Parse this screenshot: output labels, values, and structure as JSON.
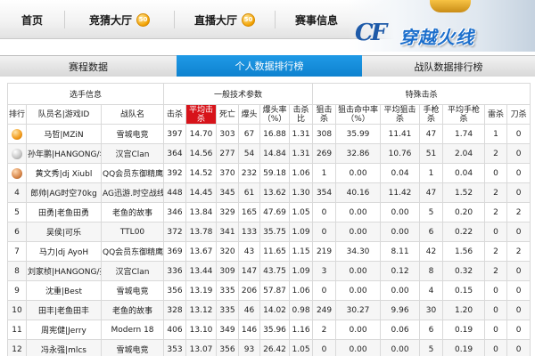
{
  "nav": {
    "items": [
      {
        "label": "首页",
        "badge": ""
      },
      {
        "label": "竞猜大厅",
        "badge": "50"
      },
      {
        "label": "直播大厅",
        "badge": "50"
      },
      {
        "label": "赛事信息",
        "badge": ""
      }
    ],
    "logo_text": "穿越火线",
    "logo_letters": "CF"
  },
  "tabs": [
    {
      "label": "赛程数据",
      "active": false
    },
    {
      "label": "个人数据排行榜",
      "active": true
    },
    {
      "label": "战队数据排行榜",
      "active": false
    }
  ],
  "table": {
    "groups": [
      "选手信息",
      "一般技术参数",
      "特殊击杀"
    ],
    "columns": [
      "排行",
      "队员名|游戏ID",
      "战队名",
      "击杀",
      "平均击杀",
      "死亡",
      "爆头",
      "爆头率（%）",
      "击杀比",
      "狙击杀",
      "狙击命中率（%）",
      "平均狙击杀",
      "手枪杀",
      "平均手枪杀",
      "雷杀",
      "刀杀"
    ],
    "highlight_column": 4,
    "rows": [
      {
        "rank": "",
        "medal": "gold",
        "name": "马哲|MZiN",
        "team": "雪城电竞",
        "kills": "397",
        "avg": "14.70",
        "deaths": "303",
        "hs": "67",
        "hsr": "16.88",
        "kd": "1.31",
        "snipe": "308",
        "snipe_rate": "35.99",
        "avg_snipe": "11.41",
        "pistol": "47",
        "avg_pistol": "1.74",
        "nade": "1",
        "knife": "0"
      },
      {
        "rank": "",
        "medal": "silver",
        "name": "孙年鹏|HANGONG/年鹏",
        "team": "汉宫Clan",
        "kills": "364",
        "avg": "14.56",
        "deaths": "277",
        "hs": "54",
        "hsr": "14.84",
        "kd": "1.31",
        "snipe": "269",
        "snipe_rate": "32.86",
        "avg_snipe": "10.76",
        "pistol": "51",
        "avg_pistol": "2.04",
        "nade": "2",
        "knife": "0"
      },
      {
        "rank": "",
        "medal": "bronze",
        "name": "黄文秀|dj Xiubl",
        "team": "QQ会员东御精鹰",
        "kills": "392",
        "avg": "14.52",
        "deaths": "370",
        "hs": "232",
        "hsr": "59.18",
        "kd": "1.06",
        "snipe": "1",
        "snipe_rate": "0.00",
        "avg_snipe": "0.04",
        "pistol": "1",
        "avg_pistol": "0.04",
        "nade": "0",
        "knife": "0"
      },
      {
        "rank": "4",
        "medal": "",
        "name": "郎帅|AG时空70kg",
        "team": "AG迅游.时空战线",
        "kills": "448",
        "avg": "14.45",
        "deaths": "345",
        "hs": "61",
        "hsr": "13.62",
        "kd": "1.30",
        "snipe": "354",
        "snipe_rate": "40.16",
        "avg_snipe": "11.42",
        "pistol": "47",
        "avg_pistol": "1.52",
        "nade": "2",
        "knife": "0"
      },
      {
        "rank": "5",
        "medal": "",
        "name": "田勇|老鱼田勇",
        "team": "老鱼的故事",
        "kills": "346",
        "avg": "13.84",
        "deaths": "329",
        "hs": "165",
        "hsr": "47.69",
        "kd": "1.05",
        "snipe": "0",
        "snipe_rate": "0.00",
        "avg_snipe": "0.00",
        "pistol": "5",
        "avg_pistol": "0.20",
        "nade": "2",
        "knife": "2"
      },
      {
        "rank": "6",
        "medal": "",
        "name": "吴侯|可乐",
        "team": "TTL00",
        "kills": "372",
        "avg": "13.78",
        "deaths": "341",
        "hs": "133",
        "hsr": "35.75",
        "kd": "1.09",
        "snipe": "0",
        "snipe_rate": "0.00",
        "avg_snipe": "0.00",
        "pistol": "6",
        "avg_pistol": "0.22",
        "nade": "0",
        "knife": "0"
      },
      {
        "rank": "7",
        "medal": "",
        "name": "马力|dj AyoH",
        "team": "QQ会员东御精鹰",
        "kills": "369",
        "avg": "13.67",
        "deaths": "320",
        "hs": "43",
        "hsr": "11.65",
        "kd": "1.15",
        "snipe": "219",
        "snipe_rate": "34.30",
        "avg_snipe": "8.11",
        "pistol": "42",
        "avg_pistol": "1.56",
        "nade": "2",
        "knife": "2"
      },
      {
        "rank": "8",
        "medal": "",
        "name": "刘家桢|HANGONG/亮亮",
        "team": "汉宫Clan",
        "kills": "336",
        "avg": "13.44",
        "deaths": "309",
        "hs": "147",
        "hsr": "43.75",
        "kd": "1.09",
        "snipe": "3",
        "snipe_rate": "0.00",
        "avg_snipe": "0.12",
        "pistol": "8",
        "avg_pistol": "0.32",
        "nade": "2",
        "knife": "0"
      },
      {
        "rank": "9",
        "medal": "",
        "name": "沈重|Best",
        "team": "雪城电竞",
        "kills": "356",
        "avg": "13.19",
        "deaths": "335",
        "hs": "206",
        "hsr": "57.87",
        "kd": "1.06",
        "snipe": "0",
        "snipe_rate": "0.00",
        "avg_snipe": "0.00",
        "pistol": "4",
        "avg_pistol": "0.15",
        "nade": "0",
        "knife": "0"
      },
      {
        "rank": "10",
        "medal": "",
        "name": "田丰|老鱼田丰",
        "team": "老鱼的故事",
        "kills": "328",
        "avg": "13.12",
        "deaths": "335",
        "hs": "46",
        "hsr": "14.02",
        "kd": "0.98",
        "snipe": "249",
        "snipe_rate": "30.27",
        "avg_snipe": "9.96",
        "pistol": "30",
        "avg_pistol": "1.20",
        "nade": "0",
        "knife": "0"
      },
      {
        "rank": "11",
        "medal": "",
        "name": "周宪健|Jerry",
        "team": "Modern 18",
        "kills": "406",
        "avg": "13.10",
        "deaths": "349",
        "hs": "146",
        "hsr": "35.96",
        "kd": "1.16",
        "snipe": "2",
        "snipe_rate": "0.00",
        "avg_snipe": "0.06",
        "pistol": "6",
        "avg_pistol": "0.19",
        "nade": "0",
        "knife": "0"
      },
      {
        "rank": "12",
        "medal": "",
        "name": "冯永强|mlcs",
        "team": "雪城电竞",
        "kills": "353",
        "avg": "13.07",
        "deaths": "356",
        "hs": "93",
        "hsr": "26.42",
        "kd": "1.05",
        "snipe": "0",
        "snipe_rate": "0.00",
        "avg_snipe": "0.00",
        "pistol": "5",
        "avg_pistol": "0.19",
        "nade": "0",
        "knife": "0"
      }
    ]
  },
  "colors": {
    "tab_active": "#1387d6",
    "highlight_header": "#d7131a",
    "badge": "#f2a100"
  }
}
